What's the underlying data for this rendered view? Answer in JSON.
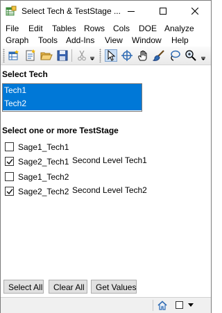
{
  "window": {
    "title": "Select Tech & TestStage ...",
    "icon": "app-icon"
  },
  "menu": {
    "row1": [
      "File",
      "Edit",
      "Tables",
      "Rows",
      "Cols",
      "DOE",
      "Analyze"
    ],
    "row2": [
      "Graph",
      "Tools",
      "Add-Ins",
      "View",
      "Window",
      "Help"
    ]
  },
  "toolbar": {
    "icons": [
      "new-table-icon",
      "new-script-icon",
      "open-folder-icon",
      "save-icon",
      "cut-icon",
      "arrow-select-icon",
      "crosshair-icon",
      "hand-icon",
      "brush-icon",
      "lasso-icon",
      "magnifier-icon"
    ],
    "pressed": "arrow-select-icon"
  },
  "select_tech": {
    "label": "Select Tech",
    "items": [
      {
        "label": "Tech1",
        "selected": true
      },
      {
        "label": "Tech2",
        "selected": true
      }
    ]
  },
  "teststage": {
    "label": "Select one or more TestStage",
    "items": [
      {
        "label": "Sage1_Tech1",
        "checked": false,
        "desc": ""
      },
      {
        "label": "Sage2_Tech1",
        "checked": true,
        "desc": "Second Level Tech1"
      },
      {
        "label": "Sage1_Tech2",
        "checked": false,
        "desc": ""
      },
      {
        "label": "Sage2_Tech2",
        "checked": true,
        "desc": "Second Level Tech2"
      }
    ]
  },
  "buttons": {
    "select_all": "Select All",
    "clear_all": "Clear All",
    "get_values": "Get Values"
  },
  "colors": {
    "selection": "#0078d7",
    "window_bg": "#f0f0f0"
  }
}
